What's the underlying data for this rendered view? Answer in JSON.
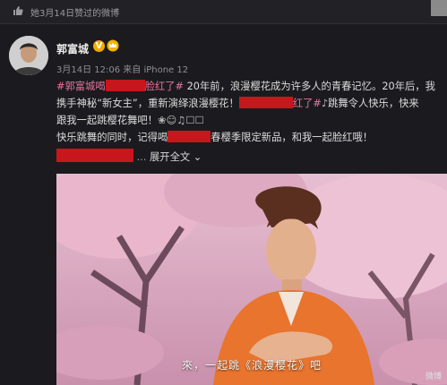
{
  "topbar": {
    "text": "她3月14日赞过的微博",
    "icon": "thumbs-up-icon"
  },
  "post": {
    "author": "郭富城",
    "verified_badge": "V",
    "meta": "3月14日 12:06 来自 iPhone 12",
    "line1_tag_start": "#郭富城喝",
    "line1_tag_end": "脸红了#",
    "line1_text": " 20年前，浪漫樱花成为许多人的青春记忆。20年后，我",
    "line2_pre": "携手神秘“新女主”，重新演绎浪漫樱花！",
    "line2_tag_end": "红了#",
    "line2_post": "跳舞令人快乐，快来",
    "line3": "跟我一起跳樱花舞吧！",
    "line4_pre": "快乐跳舞的同时，记得喝",
    "line4_post": "春樱季限定新品，和我一起脸红哦！",
    "line5_sep": "...",
    "expand_label": "展开全文",
    "expand_icon": "chevron-down-icon"
  },
  "media": {
    "caption": "來，一起跳《浪漫樱花》吧",
    "watermark": "微博"
  },
  "colors": {
    "tag": "#e8749a",
    "redaction": "#c8161d",
    "background": "#1b1b1f"
  }
}
